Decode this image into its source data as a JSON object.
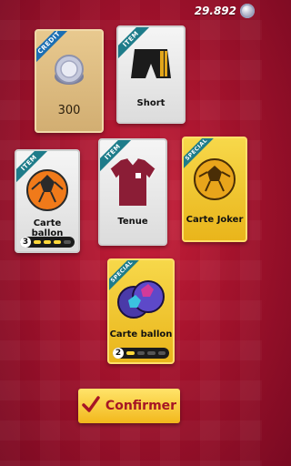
{
  "header": {
    "coins": "29.892",
    "coin_icon": "silver-coin-icon"
  },
  "cards": [
    {
      "id": "credit",
      "ribbon": "CREDIT",
      "label": "300",
      "style": "credit"
    },
    {
      "id": "short",
      "ribbon": "ITEM",
      "label": "Short",
      "style": "silver"
    },
    {
      "id": "carte-ballon-1",
      "ribbon": "ITEM",
      "label": "Carte ballon",
      "style": "silver",
      "level": "3",
      "level_segments": 4,
      "level_filled": 3
    },
    {
      "id": "tenue",
      "ribbon": "ITEM",
      "label": "Tenue",
      "style": "silver"
    },
    {
      "id": "carte-joker",
      "ribbon": "SPECIAL",
      "label": "Carte Joker",
      "style": "gold"
    },
    {
      "id": "carte-ballon-2",
      "ribbon": "SPECIAL",
      "label": "Carte ballon",
      "style": "gold",
      "level": "2",
      "level_segments": 4,
      "level_filled": 1
    }
  ],
  "confirm_button": {
    "label": "Confirmer",
    "icon": "checkmark-icon"
  },
  "colors": {
    "accent": "#f2b81c",
    "button_text": "#a61525",
    "background": "#a3122c"
  }
}
